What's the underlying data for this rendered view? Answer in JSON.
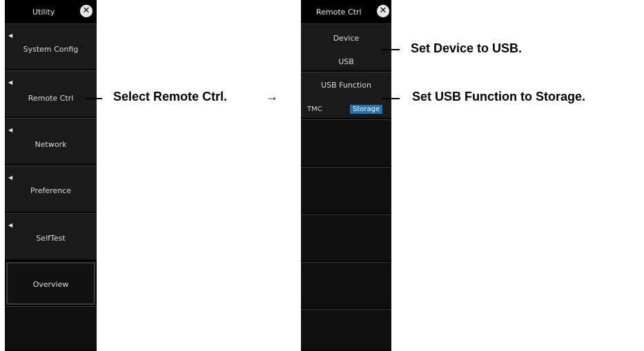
{
  "utility": {
    "title": "Utility",
    "items": [
      {
        "label": "System Config"
      },
      {
        "label": "Remote Ctrl"
      },
      {
        "label": "Network"
      },
      {
        "label": "Preference"
      },
      {
        "label": "SelfTest"
      }
    ],
    "overview_label": "Overview"
  },
  "remote_ctrl": {
    "title": "Remote Ctrl",
    "device_label": "Device",
    "device_value": "USB",
    "usb_function_label": "USB Function",
    "usb_function_options": [
      "TMC",
      "Storage"
    ],
    "usb_function_selected": "Storage"
  },
  "annotations": {
    "select_remote": "Select Remote Ctrl.",
    "set_device": "Set Device to USB.",
    "set_usb_function": "Set USB Function to Storage."
  },
  "colors": {
    "panel_bg": "#000000",
    "cell_bg": "#1a1a1a",
    "highlight": "#1f74b8"
  }
}
